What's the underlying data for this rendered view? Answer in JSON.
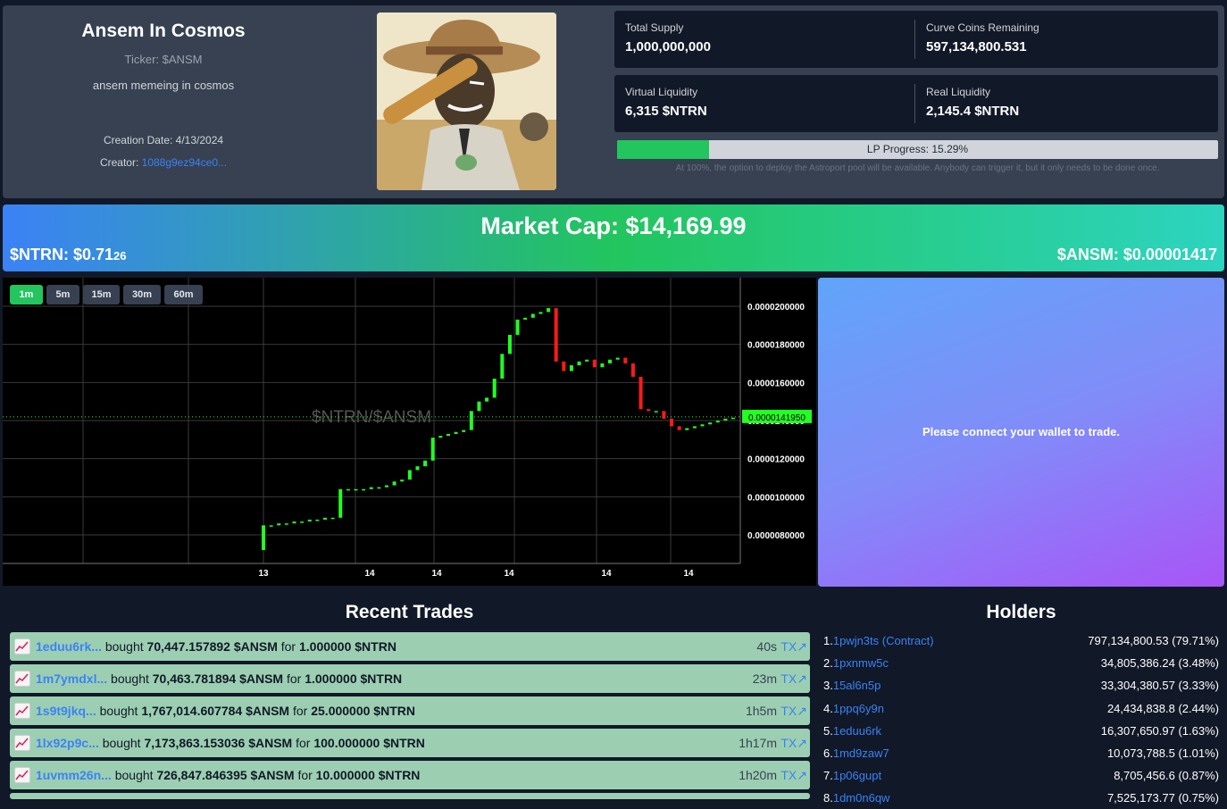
{
  "token": {
    "name": "Ansem In Cosmos",
    "ticker": "Ticker: $ANSM",
    "description": "ansem memeing in cosmos",
    "creation_date": "Creation Date: 4/13/2024",
    "creator_label": "Creator:",
    "creator_address": "1088g9ez94ce0..."
  },
  "stats": {
    "total_supply_label": "Total Supply",
    "total_supply": "1,000,000,000",
    "curve_label": "Curve Coins Remaining",
    "curve_value": "597,134,800.531",
    "virtual_liq_label": "Virtual Liquidity",
    "virtual_liq": "6,315 $NTRN",
    "real_liq_label": "Real Liquidity",
    "real_liq": "2,145.4 $NTRN"
  },
  "lp": {
    "progress": 15.29,
    "label": "LP Progress: 15.29%",
    "note": "At 100%, the option to deploy the Astroport pool will be available. Anybody can trigger it, but it only needs to be done once."
  },
  "market": {
    "market_cap": "Market Cap: $14,169.99",
    "ntrn_price_main": "$NTRN: $0.71",
    "ntrn_price_small": "26",
    "token_price": "$ANSM: $0.00001417"
  },
  "timeframes": [
    {
      "label": "1m",
      "active": true
    },
    {
      "label": "5m",
      "active": false
    },
    {
      "label": "15m",
      "active": false
    },
    {
      "label": "30m",
      "active": false
    },
    {
      "label": "60m",
      "active": false
    }
  ],
  "chart_data": {
    "type": "candlestick",
    "watermark": "$NTRN/$ANSM",
    "ylim": [
      6.5e-06,
      2.15e-05
    ],
    "y_ticks": [
      "0.0000200000",
      "0.0000180000",
      "0.0000160000",
      "0.0000140000",
      "0.0000120000",
      "0.0000100000",
      "0.0000080000"
    ],
    "y_tick_values": [
      2e-05,
      1.8e-05,
      1.6e-05,
      1.4e-05,
      1.2e-05,
      1e-05,
      8e-06
    ],
    "x_ticks": [
      "13",
      "14",
      "14",
      "14",
      "14",
      "14"
    ],
    "last_price_label": "0.0000141950",
    "last_price": 1.4195e-05,
    "up_color": "#22ff22",
    "down_color": "#ff1a1a",
    "candles": [
      [
        7.2e-06,
        8.5e-06
      ],
      [
        8.5e-06,
        8.5e-06
      ],
      [
        8.5e-06,
        8.6e-06
      ],
      [
        8.6e-06,
        8.6e-06
      ],
      [
        8.6e-06,
        8.7e-06
      ],
      [
        8.7e-06,
        8.7e-06
      ],
      [
        8.7e-06,
        8.8e-06
      ],
      [
        8.8e-06,
        8.8e-06
      ],
      [
        8.8e-06,
        8.9e-06
      ],
      [
        8.9e-06,
        8.9e-06
      ],
      [
        8.9e-06,
        1.04e-05
      ],
      [
        1.04e-05,
        1.04e-05
      ],
      [
        1.04e-05,
        1.04e-05
      ],
      [
        1.04e-05,
        1.04e-05
      ],
      [
        1.04e-05,
        1.05e-05
      ],
      [
        1.05e-05,
        1.05e-05
      ],
      [
        1.05e-05,
        1.06e-05
      ],
      [
        1.06e-05,
        1.08e-05
      ],
      [
        1.08e-05,
        1.09e-05
      ],
      [
        1.09e-05,
        1.14e-05
      ],
      [
        1.14e-05,
        1.16e-05
      ],
      [
        1.16e-05,
        1.19e-05
      ],
      [
        1.19e-05,
        1.31e-05
      ],
      [
        1.31e-05,
        1.32e-05
      ],
      [
        1.32e-05,
        1.33e-05
      ],
      [
        1.33e-05,
        1.34e-05
      ],
      [
        1.34e-05,
        1.35e-05
      ],
      [
        1.35e-05,
        1.45e-05
      ],
      [
        1.45e-05,
        1.5e-05
      ],
      [
        1.5e-05,
        1.52e-05
      ],
      [
        1.52e-05,
        1.62e-05
      ],
      [
        1.62e-05,
        1.75e-05
      ],
      [
        1.75e-05,
        1.85e-05
      ],
      [
        1.85e-05,
        1.93e-05
      ],
      [
        1.93e-05,
        1.94e-05
      ],
      [
        1.94e-05,
        1.96e-05
      ],
      [
        1.96e-05,
        1.97e-05
      ],
      [
        1.97e-05,
        1.99e-05
      ],
      [
        1.99e-05,
        1.71e-05
      ],
      [
        1.71e-05,
        1.66e-05
      ],
      [
        1.66e-05,
        1.69e-05
      ],
      [
        1.69e-05,
        1.71e-05
      ],
      [
        1.71e-05,
        1.72e-05
      ],
      [
        1.72e-05,
        1.68e-05
      ],
      [
        1.68e-05,
        1.7e-05
      ],
      [
        1.7e-05,
        1.72e-05
      ],
      [
        1.72e-05,
        1.73e-05
      ],
      [
        1.73e-05,
        1.7e-05
      ],
      [
        1.7e-05,
        1.63e-05
      ],
      [
        1.63e-05,
        1.46e-05
      ],
      [
        1.46e-05,
        1.45e-05
      ],
      [
        1.45e-05,
        1.45e-05
      ],
      [
        1.45e-05,
        1.41e-05
      ],
      [
        1.41e-05,
        1.37e-05
      ],
      [
        1.37e-05,
        1.35e-05
      ],
      [
        1.35e-05,
        1.36e-05
      ],
      [
        1.36e-05,
        1.37e-05
      ],
      [
        1.37e-05,
        1.38e-05
      ],
      [
        1.38e-05,
        1.39e-05
      ],
      [
        1.39e-05,
        1.4e-05
      ],
      [
        1.4e-05,
        1.41e-05
      ],
      [
        1.41e-05,
        1.415e-05
      ]
    ]
  },
  "trade": {
    "connect_msg": "Please connect your wallet to trade."
  },
  "trades_title": "Recent Trades",
  "trades": [
    {
      "addr": "1eduu6rk...",
      "action": "bought",
      "amount": "70,447.157892 $ANSM",
      "for": "for",
      "cost": "1.000000 $NTRN",
      "age": "40s",
      "tx": "TX↗"
    },
    {
      "addr": "1m7ymdxl...",
      "action": "bought",
      "amount": "70,463.781894 $ANSM",
      "for": "for",
      "cost": "1.000000 $NTRN",
      "age": "23m",
      "tx": "TX↗"
    },
    {
      "addr": "1s9t9jkq...",
      "action": "bought",
      "amount": "1,767,014.607784 $ANSM",
      "for": "for",
      "cost": "25.000000 $NTRN",
      "age": "1h5m",
      "tx": "TX↗"
    },
    {
      "addr": "1lx92p9c...",
      "action": "bought",
      "amount": "7,173,863.153036 $ANSM",
      "for": "for",
      "cost": "100.000000 $NTRN",
      "age": "1h17m",
      "tx": "TX↗"
    },
    {
      "addr": "1uvmm26n...",
      "action": "bought",
      "amount": "726,847.846395 $ANSM",
      "for": "for",
      "cost": "10.000000 $NTRN",
      "age": "1h20m",
      "tx": "TX↗"
    }
  ],
  "holders_title": "Holders",
  "holders": [
    {
      "num": "1.",
      "addr": "1pwjn3ts (Contract)",
      "amount": "797,134,800.53 (79.71%)"
    },
    {
      "num": "2.",
      "addr": "1pxnmw5c",
      "amount": "34,805,386.24 (3.48%)"
    },
    {
      "num": "3.",
      "addr": "15al6n5p",
      "amount": "33,304,380.57 (3.33%)"
    },
    {
      "num": "4.",
      "addr": "1ppq6y9n",
      "amount": "24,434,838.8 (2.44%)"
    },
    {
      "num": "5.",
      "addr": "1eduu6rk",
      "amount": "16,307,650.97 (1.63%)"
    },
    {
      "num": "6.",
      "addr": "1md9zaw7",
      "amount": "10,073,788.5 (1.01%)"
    },
    {
      "num": "7.",
      "addr": "1p06gupt",
      "amount": "8,705,456.6 (0.87%)"
    },
    {
      "num": "8.",
      "addr": "1dm0n6qw",
      "amount": "7,525,173.77 (0.75%)"
    }
  ]
}
